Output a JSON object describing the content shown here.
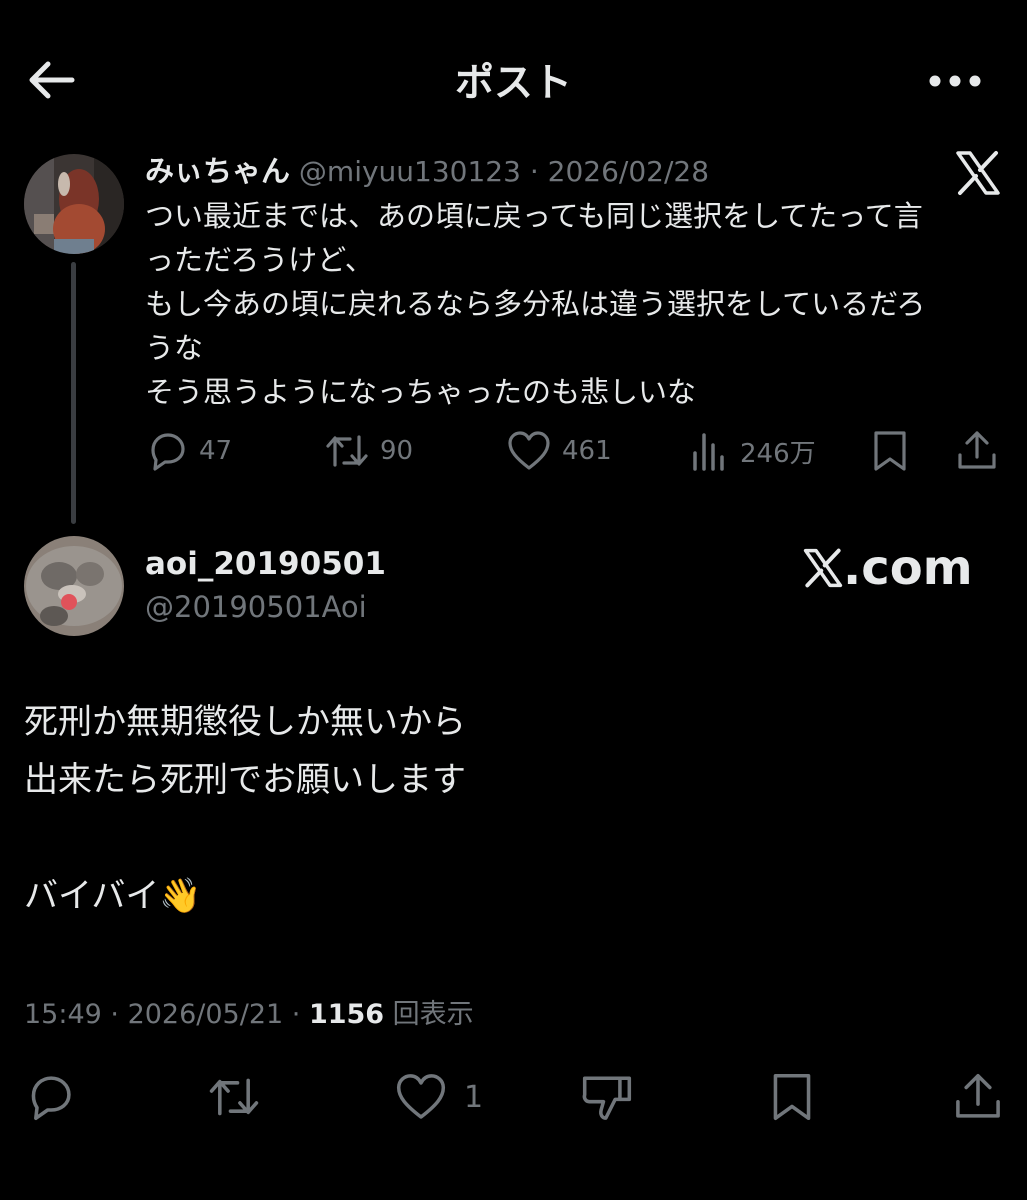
{
  "header": {
    "title": "ポスト"
  },
  "quoted_tweet": {
    "name": "みぃちゃん",
    "handle": "@miyuu130123",
    "separator": " · ",
    "date": "2026/02/28",
    "lines": [
      "つい最近までは、あの頃に戻っても同じ選択をしてたって言",
      "っただろうけど、",
      "もし今あの頃に戻れるなら多分私は違う選択をしているだろ",
      "うな",
      "そう思うようになっちゃったのも悲しいな"
    ],
    "replies": "47",
    "reposts": "90",
    "likes": "461",
    "views": "246万"
  },
  "main_tweet": {
    "name": "aoi_20190501",
    "handle": "@20190501Aoi",
    "watermark": ".com",
    "lines": [
      "死刑か無期懲役しか無いから",
      "出来たら死刑でお願いします",
      "",
      "バイバイ👋"
    ],
    "time": "15:49",
    "separator": " · ",
    "date": "2026/05/21",
    "view_count": "1156",
    "view_label": " 回表示",
    "likes": "1"
  },
  "colors": {
    "background": "#000000",
    "text": "#e7e9ea",
    "secondary": "#71767b",
    "thread_line": "#3a3d41"
  },
  "icons": [
    "back-arrow-icon",
    "more-icon",
    "x-logo-icon",
    "reply-icon",
    "repost-icon",
    "like-icon",
    "views-icon",
    "bookmark-icon",
    "share-icon",
    "dislike-icon"
  ]
}
